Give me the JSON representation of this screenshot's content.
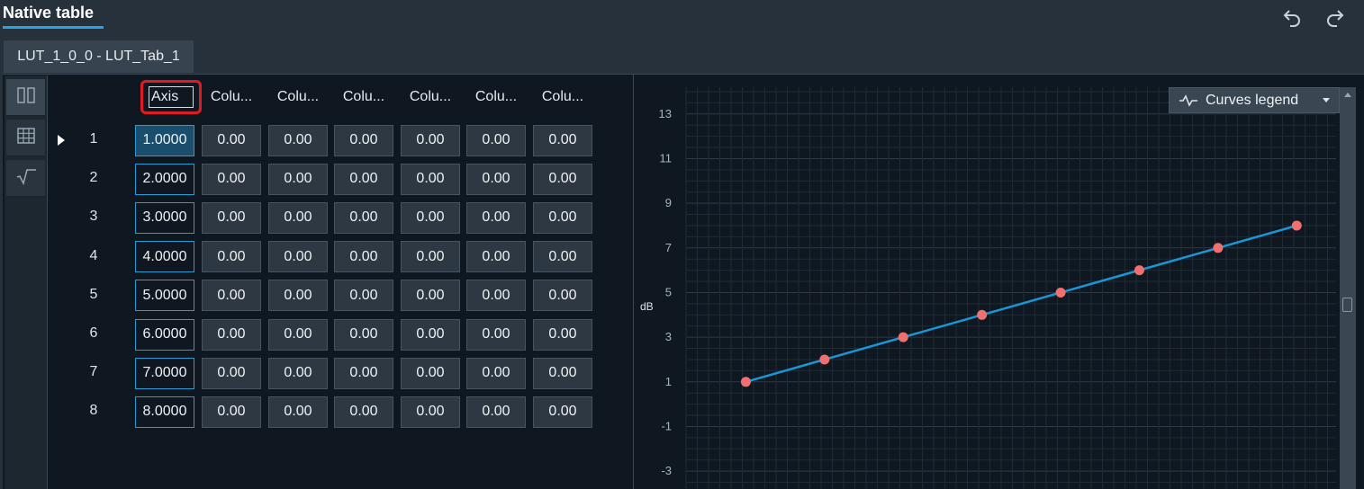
{
  "header": {
    "title": "Native table",
    "undo_icon": "undo-icon",
    "redo_icon": "redo-icon"
  },
  "tab": {
    "label": "LUT_1_0_0 - LUT_Tab_1"
  },
  "sidebar": {
    "items": [
      {
        "icon": "columns-view-icon",
        "active": true
      },
      {
        "icon": "table-grid-icon",
        "active": false
      },
      {
        "icon": "formula-icon",
        "active": false
      }
    ]
  },
  "table": {
    "axis_header": "Axis",
    "columns": [
      "Colu...",
      "Colu...",
      "Colu...",
      "Colu...",
      "Colu...",
      "Colu..."
    ],
    "rows": [
      {
        "num": "1",
        "axis": "1.0000",
        "values": [
          "0.00",
          "0.00",
          "0.00",
          "0.00",
          "0.00",
          "0.00"
        ]
      },
      {
        "num": "2",
        "axis": "2.0000",
        "values": [
          "0.00",
          "0.00",
          "0.00",
          "0.00",
          "0.00",
          "0.00"
        ]
      },
      {
        "num": "3",
        "axis": "3.0000",
        "values": [
          "0.00",
          "0.00",
          "0.00",
          "0.00",
          "0.00",
          "0.00"
        ]
      },
      {
        "num": "4",
        "axis": "4.0000",
        "values": [
          "0.00",
          "0.00",
          "0.00",
          "0.00",
          "0.00",
          "0.00"
        ]
      },
      {
        "num": "5",
        "axis": "5.0000",
        "values": [
          "0.00",
          "0.00",
          "0.00",
          "0.00",
          "0.00",
          "0.00"
        ]
      },
      {
        "num": "6",
        "axis": "6.0000",
        "values": [
          "0.00",
          "0.00",
          "0.00",
          "0.00",
          "0.00",
          "0.00"
        ]
      },
      {
        "num": "7",
        "axis": "7.0000",
        "values": [
          "0.00",
          "0.00",
          "0.00",
          "0.00",
          "0.00",
          "0.00"
        ]
      },
      {
        "num": "8",
        "axis": "8.0000",
        "values": [
          "0.00",
          "0.00",
          "0.00",
          "0.00",
          "0.00",
          "0.00"
        ]
      }
    ],
    "selected_row": 0
  },
  "chart": {
    "legend_label": "Curves legend",
    "legend_icon": "curve-wave-icon",
    "legend_dropdown_icon": "caret-down-icon"
  },
  "chart_data": {
    "type": "line",
    "ylabel": "dB",
    "xlabel": "",
    "ylim": [
      -3.8,
      14.2
    ],
    "yticks": [
      13,
      11,
      9,
      7,
      5,
      3,
      1,
      -1,
      -3
    ],
    "x": [
      1,
      2,
      3,
      4,
      5,
      6,
      7,
      8
    ],
    "series": [
      {
        "values": [
          1,
          2,
          3,
          4,
          5,
          6,
          7,
          8
        ],
        "color": "#1a96d8",
        "marker_color": "#f07070"
      }
    ],
    "grid": true,
    "legend": "top-right"
  },
  "colors": {
    "accent": "#2aa3e6",
    "focus_outline": "#e01b24",
    "line": "#1a96d8",
    "marker": "#f07070"
  }
}
